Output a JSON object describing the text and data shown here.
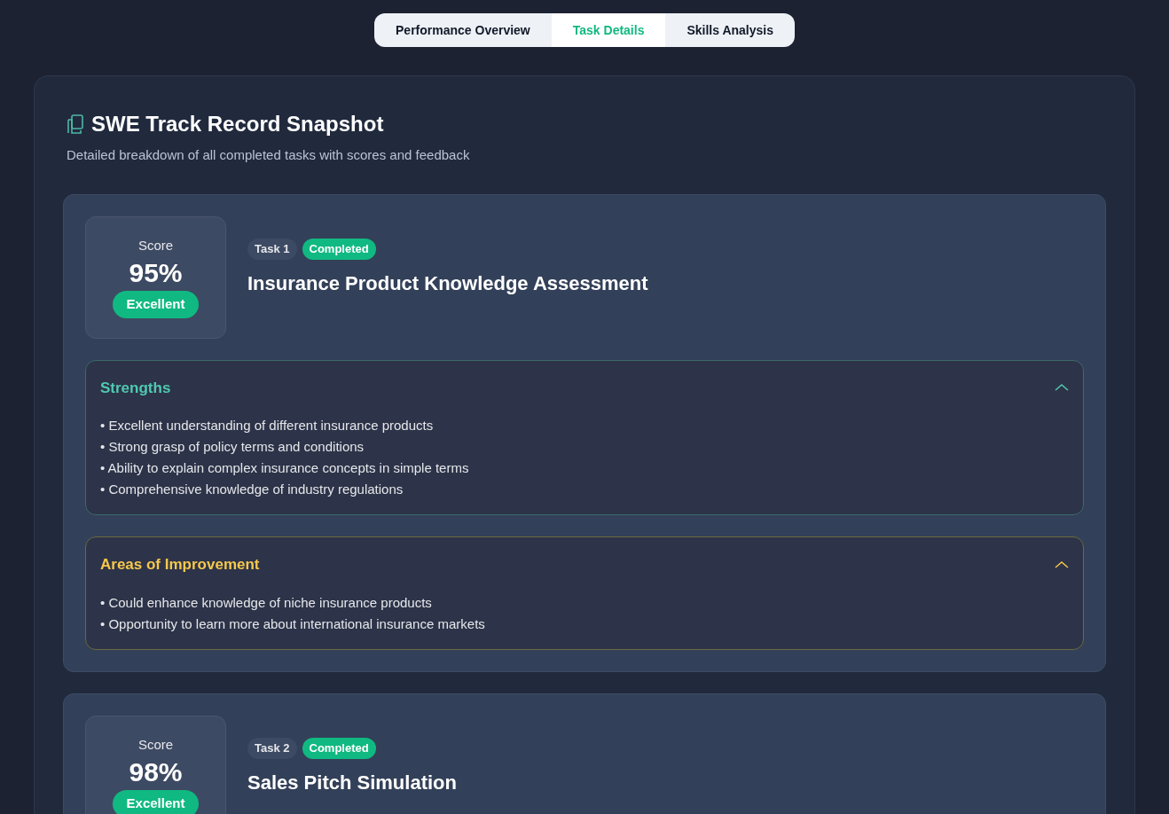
{
  "tabs": [
    {
      "label": "Performance Overview",
      "selected": false
    },
    {
      "label": "Task Details",
      "selected": true
    },
    {
      "label": "Skills Analysis",
      "selected": false
    }
  ],
  "header": {
    "title": "SWE Track Record Snapshot",
    "subtitle": "Detailed breakdown of all completed tasks with scores and feedback"
  },
  "tasks": [
    {
      "score_label": "Score",
      "score": "95%",
      "rating": "Excellent",
      "task": "Task 1",
      "status": "Completed",
      "title": "Insurance Product Knowledge Assessment",
      "sections": [
        {
          "kind": "strengths",
          "title": "Strengths",
          "expanded": true,
          "items": [
            "• Excellent understanding of different insurance products",
            "• Strong grasp of policy terms and conditions",
            "• Ability to explain complex insurance concepts in simple terms",
            "• Comprehensive knowledge of industry regulations"
          ]
        },
        {
          "kind": "improvement",
          "title": "Areas of Improvement",
          "expanded": true,
          "items": [
            "• Could enhance knowledge of niche insurance products",
            "• Opportunity to learn more about international insurance markets"
          ]
        }
      ]
    },
    {
      "score_label": "Score",
      "score": "98%",
      "rating": "Excellent",
      "task": "Task 2",
      "status": "Completed",
      "title": "Sales Pitch Simulation"
    }
  ]
}
